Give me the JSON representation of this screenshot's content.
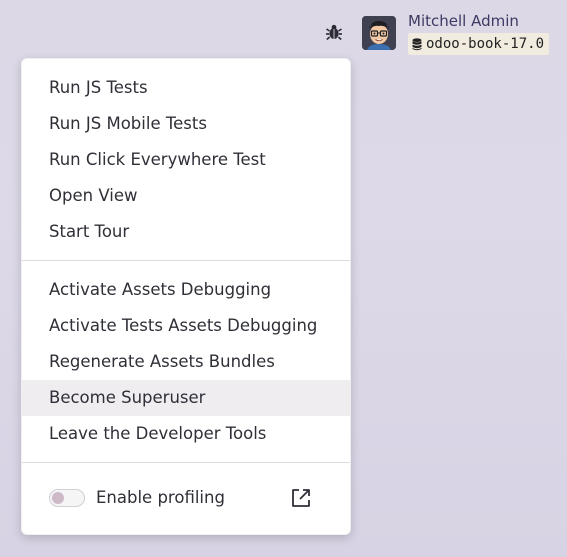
{
  "header": {
    "user_name": "Mitchell Admin",
    "database_name": "odoo-book-17.0",
    "icons": {
      "debug": "bug-icon",
      "database": "database-icon",
      "avatar": "user-avatar"
    }
  },
  "menu": {
    "group1": [
      {
        "label": "Run JS Tests"
      },
      {
        "label": "Run JS Mobile Tests"
      },
      {
        "label": "Run Click Everywhere Test"
      },
      {
        "label": "Open View"
      },
      {
        "label": "Start Tour"
      }
    ],
    "group2": [
      {
        "label": "Activate Assets Debugging"
      },
      {
        "label": "Activate Tests Assets Debugging"
      },
      {
        "label": "Regenerate Assets Bundles"
      },
      {
        "label": "Become Superuser"
      },
      {
        "label": "Leave the Developer Tools"
      }
    ],
    "hovered_item": "Become Superuser",
    "profiling": {
      "label": "Enable profiling",
      "enabled": false,
      "icon": "external-link-icon"
    }
  },
  "colors": {
    "user_name": "#3d3a63",
    "db_badge_bg": "#f1ecdf",
    "hover_bg": "#efedf0",
    "toggle_knob": "#cdb9c8"
  }
}
